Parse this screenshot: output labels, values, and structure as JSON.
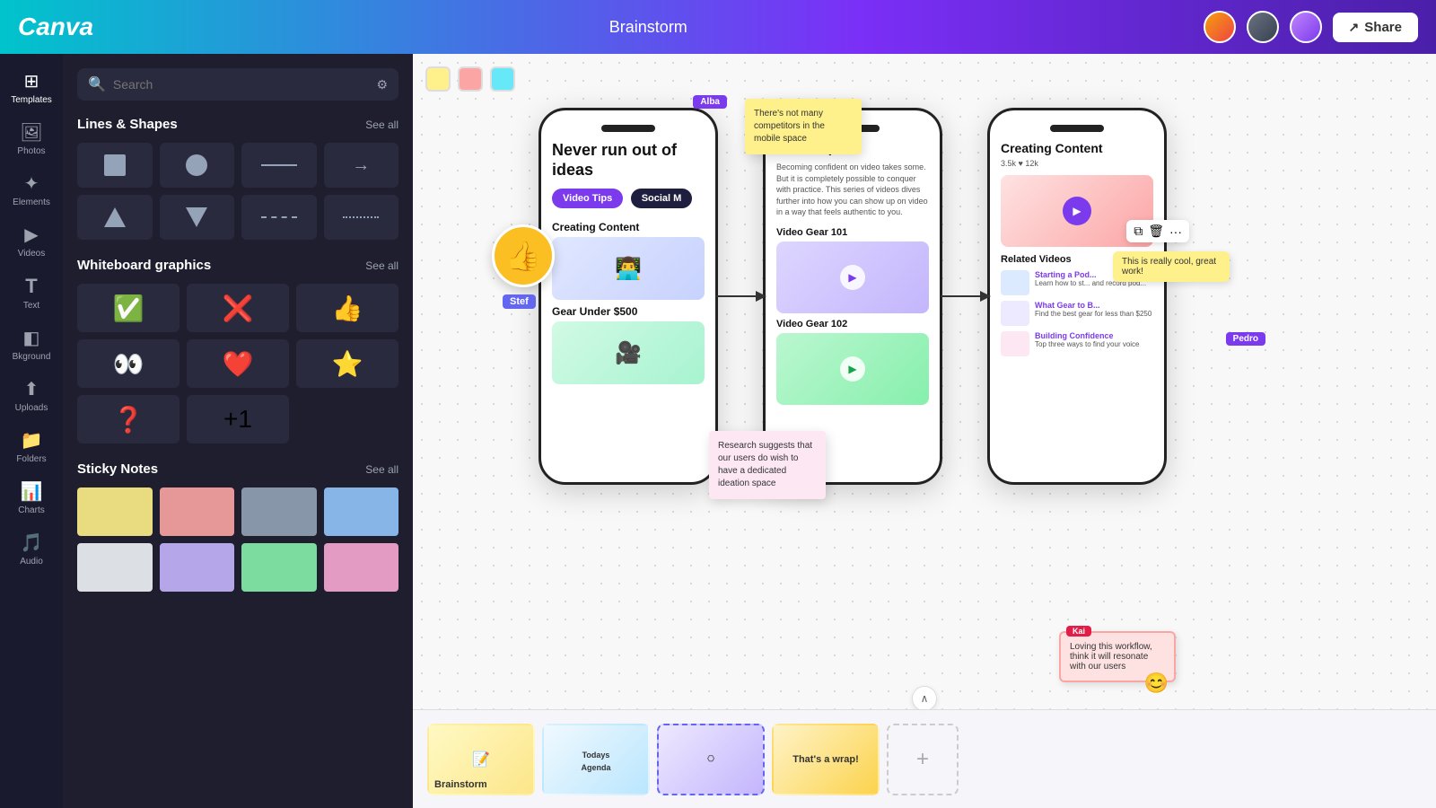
{
  "app": {
    "logo": "Canva",
    "title": "Brainstorm",
    "share_label": "Share"
  },
  "topbar": {
    "avatars": [
      "avatar-1",
      "avatar-2",
      "avatar-3"
    ]
  },
  "sidebar": {
    "items": [
      {
        "id": "templates",
        "label": "Templates",
        "icon": "⊞"
      },
      {
        "id": "photos",
        "label": "Photos",
        "icon": "🖼"
      },
      {
        "id": "elements",
        "label": "Elements",
        "icon": "✦"
      },
      {
        "id": "videos",
        "label": "Videos",
        "icon": "▶"
      },
      {
        "id": "text",
        "label": "Text",
        "icon": "T"
      },
      {
        "id": "background",
        "label": "Bkground",
        "icon": "◧"
      },
      {
        "id": "uploads",
        "label": "Uploads",
        "icon": "⬆"
      },
      {
        "id": "folders",
        "label": "Folders",
        "icon": "📁"
      },
      {
        "id": "charts",
        "label": "Charts",
        "icon": "📊"
      },
      {
        "id": "audio",
        "label": "Audio",
        "icon": "🎵"
      }
    ]
  },
  "panel": {
    "search_placeholder": "Search",
    "lines_shapes_title": "Lines & Shapes",
    "lines_shapes_see_all": "See all",
    "whiteboard_title": "Whiteboard graphics",
    "whiteboard_see_all": "See all",
    "sticky_notes_title": "Sticky Notes",
    "sticky_notes_see_all": "See all",
    "whiteboard_icons": [
      "✅",
      "❌",
      "👍",
      "👀",
      "❤️",
      "⭐",
      "❓",
      "+1"
    ]
  },
  "canvas": {
    "colors": [
      "#fef08a",
      "#fca5a5",
      "#67e8f9"
    ],
    "phone1": {
      "headline": "Never run out of ideas",
      "btn1": "Video Tips",
      "btn2": "Social M",
      "card1_label": "Creating Content",
      "card2_label": "Gear Under $500"
    },
    "phone2": {
      "title": "Video Tips",
      "description": "Becoming confident on video takes some. But it is completely possible to conquer with practice. This series of videos dives further into how you can show up on video in a way that feels authentic to you.",
      "video1_title": "Video Gear 101",
      "video2_title": "Video Gear 102"
    },
    "phone3": {
      "title": "Creating Content",
      "stats": "3.5k  ♥ 12k",
      "related_title": "Related Videos",
      "related": [
        {
          "title": "Starting a Pod...",
          "desc": "Learn how to st... and record pod..."
        },
        {
          "title": "What Gear to B...",
          "desc": "Find the best gear for less than $250"
        },
        {
          "title": "Building Confidence",
          "desc": "Top three ways to find your voice"
        }
      ]
    },
    "sticky_notes": [
      {
        "text": "There's not many competitors in the mobile space",
        "color": "#fef08a",
        "cursor_name": "Alba",
        "cursor_color": "#7c3aed"
      },
      {
        "text": "Research suggests that our users do wish to have a dedicated ideation space",
        "color": "#fca5a5",
        "color_light": "#fce7f3"
      },
      {
        "text": "This is really cool, great work!",
        "color": "#fef08a"
      },
      {
        "text": "Loving this workflow, think it will resonate with our users",
        "color": "#fee2e2",
        "cursor_name": "Kai",
        "cursor_color": "#e11d48"
      }
    ],
    "sticker_label": "Stef",
    "pedro_label": "Pedro"
  },
  "filmstrip": {
    "slides": [
      {
        "id": "brainstorm",
        "label": "Brainstorm",
        "active": false
      },
      {
        "id": "agenda",
        "label": "Todays Agenda",
        "active": false
      },
      {
        "id": "whiteboard",
        "label": "",
        "active": true
      },
      {
        "id": "wrap",
        "label": "That's a wrap!",
        "active": false
      }
    ],
    "add_slide_label": "+"
  }
}
